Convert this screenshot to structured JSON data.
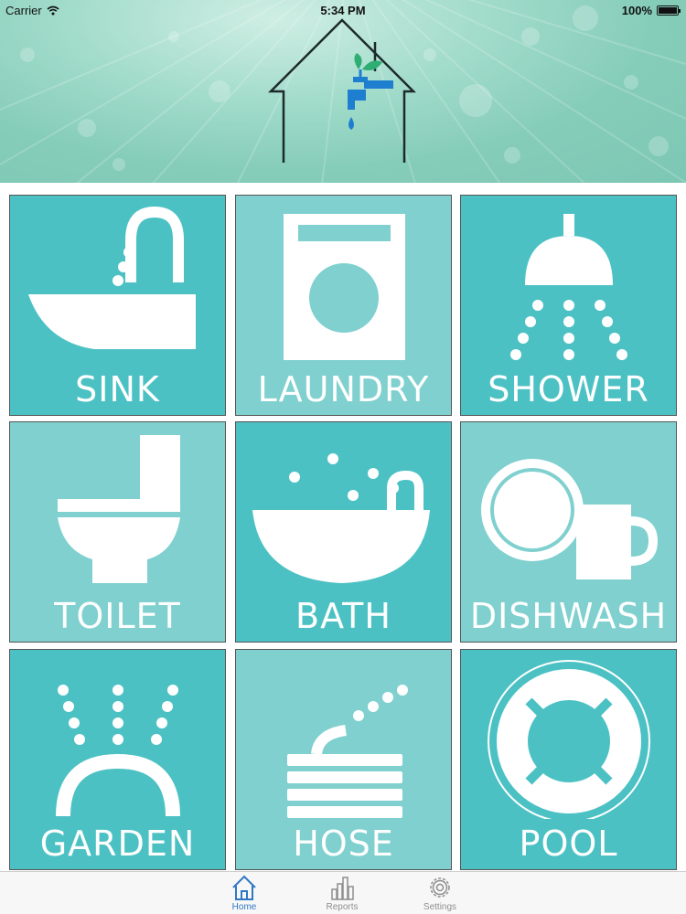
{
  "status_bar": {
    "carrier": "Carrier",
    "time": "5:34 PM",
    "battery": "100%",
    "battery_level": 1.0
  },
  "colors": {
    "tile_dark": "#4cc1c4",
    "tile_light": "#7fd0cf",
    "tab_active": "#2f78c4",
    "tab_inactive": "#8e8e8e"
  },
  "tiles": [
    {
      "label": "SINK",
      "icon": "sink-icon"
    },
    {
      "label": "LAUNDRY",
      "icon": "washing-machine-icon"
    },
    {
      "label": "SHOWER",
      "icon": "shower-icon"
    },
    {
      "label": "TOILET",
      "icon": "toilet-icon"
    },
    {
      "label": "BATH",
      "icon": "bathtub-icon"
    },
    {
      "label": "DISHWASH",
      "icon": "dishes-icon"
    },
    {
      "label": "GARDEN",
      "icon": "sprinkler-icon"
    },
    {
      "label": "HOSE",
      "icon": "hose-icon"
    },
    {
      "label": "POOL",
      "icon": "lifebuoy-icon"
    }
  ],
  "tabs": [
    {
      "label": "Home",
      "icon": "home-icon",
      "active": true
    },
    {
      "label": "Reports",
      "icon": "bar-chart-icon",
      "active": false
    },
    {
      "label": "Settings",
      "icon": "gear-icon",
      "active": false
    }
  ]
}
